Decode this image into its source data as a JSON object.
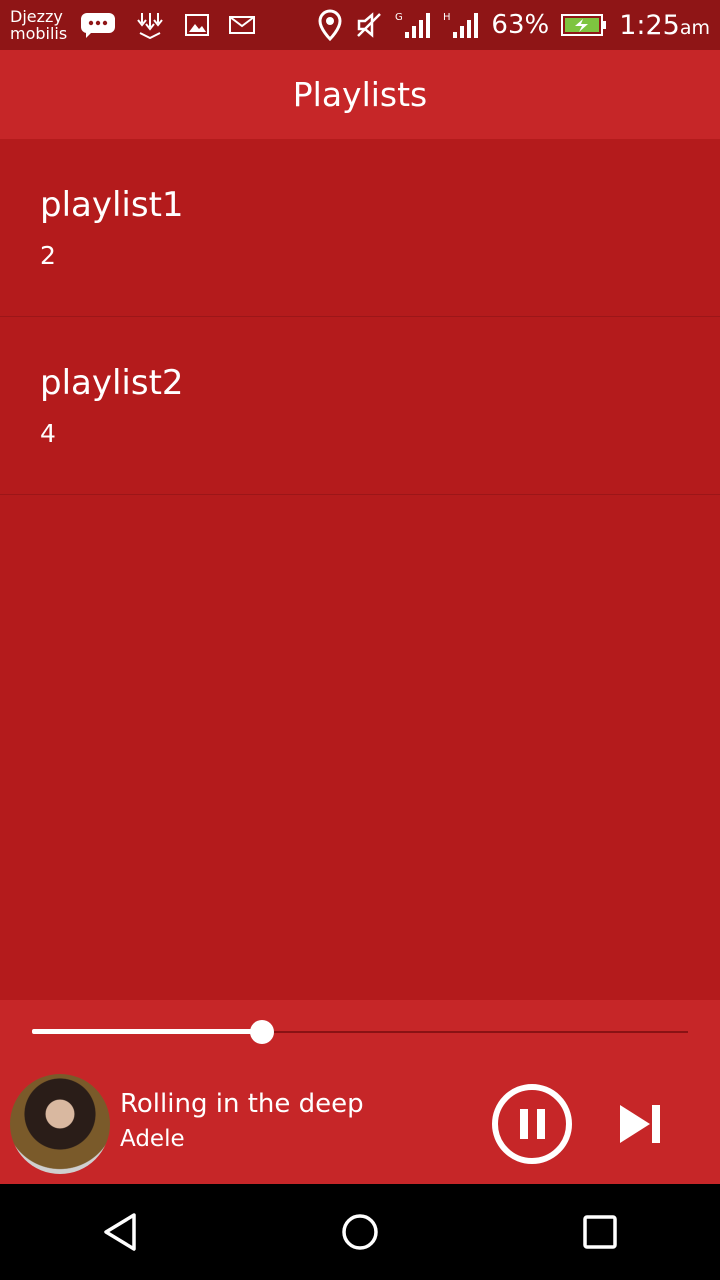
{
  "status_bar": {
    "carrier_line1": "Djezzy",
    "carrier_line2": "mobilis",
    "battery_percent": "63%",
    "time": "1:25",
    "time_suffix": "am",
    "icons": [
      "message-icon",
      "download-icon",
      "image-icon",
      "mail-icon",
      "location-icon",
      "mute-icon",
      "signal-g-icon",
      "signal-h-icon",
      "battery-charging-icon"
    ]
  },
  "app_bar": {
    "title": "Playlists"
  },
  "playlists": [
    {
      "name": "playlist1",
      "count": "2"
    },
    {
      "name": "playlist2",
      "count": "4"
    }
  ],
  "player": {
    "track_title": "Rolling in the deep",
    "artist": "Adele",
    "progress": 0.35,
    "pause_icon": "pause-icon",
    "next_icon": "skip-next-icon"
  },
  "nav_bar": {
    "icons": [
      "back-icon",
      "home-icon",
      "recents-icon"
    ]
  },
  "colors": {
    "background": "#b41b1c",
    "app_bar": "#c62628",
    "status_bar": "#8f1516",
    "text": "#ffffff"
  }
}
